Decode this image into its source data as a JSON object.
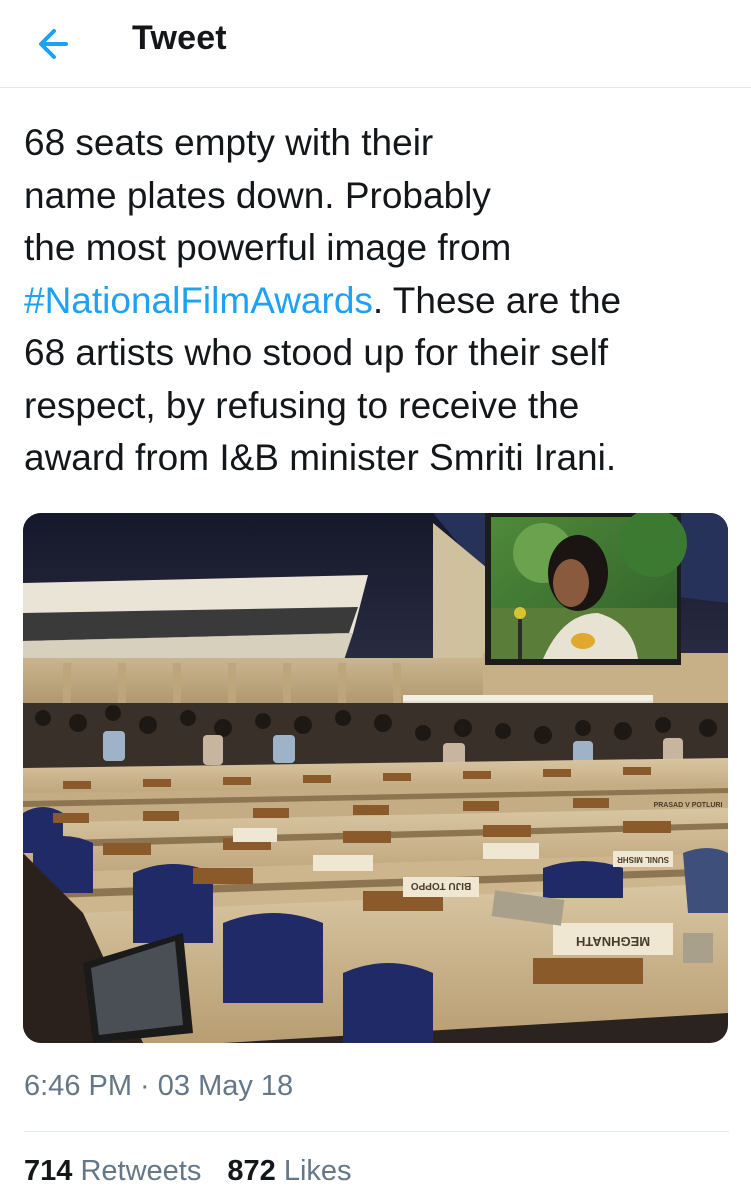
{
  "header": {
    "back_icon": "arrow-left-icon",
    "title": "Tweet",
    "accent_color": "#1da1f2"
  },
  "tweet": {
    "lines": [
      {
        "text": "68 seats empty with their"
      },
      {
        "text": "name plates down. Probably"
      },
      {
        "text": "the most powerful image from"
      },
      {
        "hashtag": "#NationalFilmAwards",
        "text": ". These are the"
      },
      {
        "text": "68 artists who stood up for their self"
      },
      {
        "text": "respect, by refusing to receive the"
      },
      {
        "text": "award from I&B minister Smriti Irani."
      }
    ],
    "hashtag_color": "#1da1f2",
    "photo": {
      "plate_labels": [
        "MEGHNATH",
        "BIJU TOPPO",
        "SUNIL MISHR",
        "PRASAD V POTLURI"
      ]
    },
    "timestamp": "6:46 PM · 03 May 18"
  },
  "stats": {
    "retweets_count": "714",
    "retweets_label": "Retweets",
    "likes_count": "872",
    "likes_label": "Likes"
  }
}
